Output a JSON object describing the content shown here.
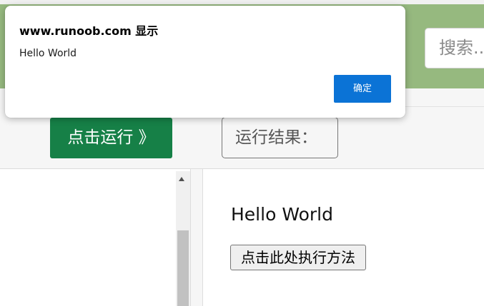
{
  "header": {
    "search_placeholder": "搜索...",
    "bg_color": "#96b97f"
  },
  "toolbar": {
    "run_label": "点击运行 》",
    "result_label": "运行结果："
  },
  "result": {
    "text": "Hello World",
    "exec_button_label": "点击此处执行方法"
  },
  "dialog": {
    "title": "www.runoob.com 显示",
    "message": "Hello World",
    "ok_label": "确定",
    "ok_color": "#0b73d6"
  },
  "colors": {
    "run_button": "#168047"
  }
}
